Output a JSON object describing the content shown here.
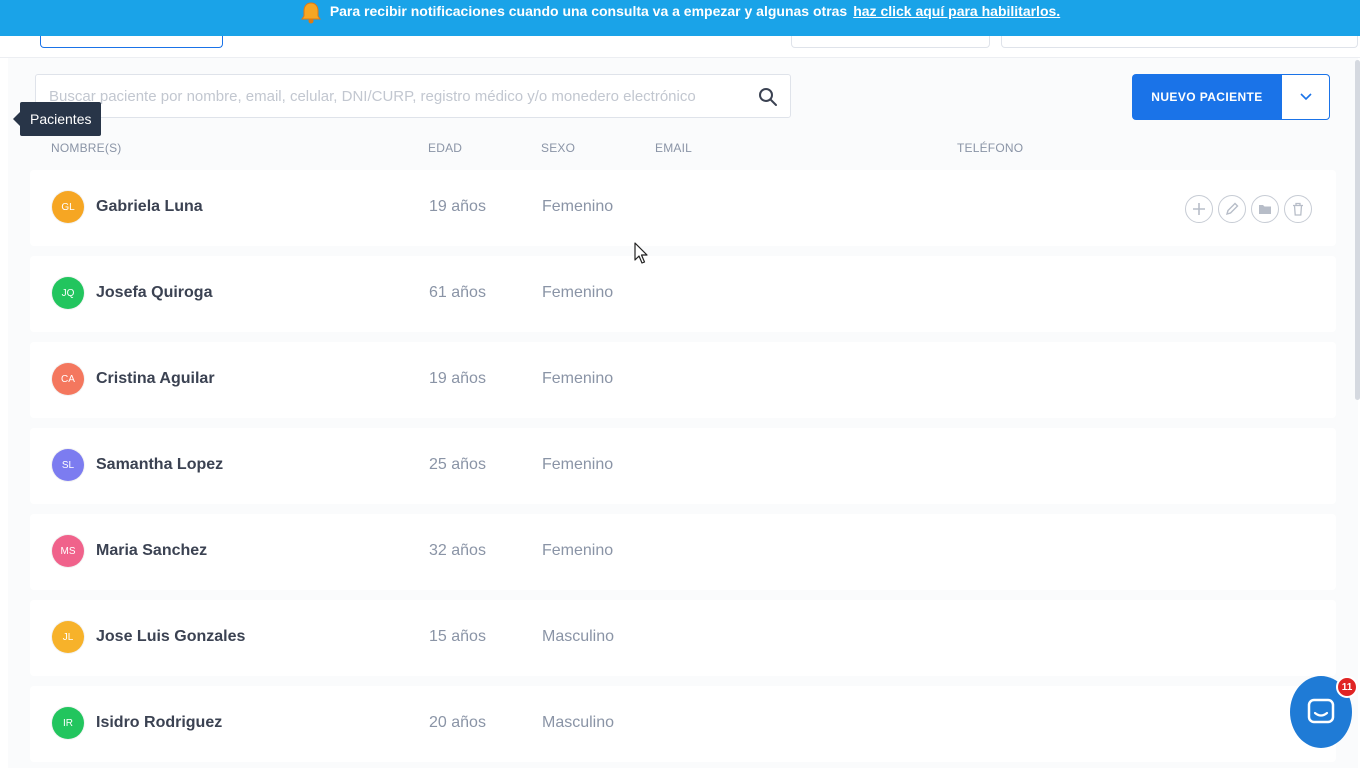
{
  "banner": {
    "text": "Para recibir notificaciones cuando una consulta va a empezar y algunas otras",
    "link": "haz click aquí para habilitarlos."
  },
  "search": {
    "placeholder": "Buscar paciente por nombre, email, celular, DNI/CURP, registro médico y/o monedero electrónico"
  },
  "new_patient": {
    "label": "NUEVO PACIENTE"
  },
  "tooltip": {
    "text": "Pacientes"
  },
  "table": {
    "headers": {
      "name": "NOMBRE(S)",
      "age": "EDAD",
      "sex": "SEXO",
      "email": "EMAIL",
      "phone": "TELÉFONO"
    },
    "rows": [
      {
        "initials": "GL",
        "color": "#f6a623",
        "name": "Gabriela Luna",
        "age": "19 años",
        "sex": "Femenino"
      },
      {
        "initials": "JQ",
        "color": "#22c55e",
        "name": "Josefa Quiroga",
        "age": "61 años",
        "sex": "Femenino"
      },
      {
        "initials": "CA",
        "color": "#f4775e",
        "name": "Cristina Aguilar",
        "age": "19 años",
        "sex": "Femenino"
      },
      {
        "initials": "SL",
        "color": "#7c7cf0",
        "name": "Samantha Lopez",
        "age": "25 años",
        "sex": "Femenino"
      },
      {
        "initials": "MS",
        "color": "#f0628b",
        "name": "Maria Sanchez",
        "age": "32 años",
        "sex": "Femenino"
      },
      {
        "initials": "JL",
        "color": "#f7b22a",
        "name": "Jose Luis Gonzales",
        "age": "15 años",
        "sex": "Masculino"
      },
      {
        "initials": "IR",
        "color": "#22c55e",
        "name": "Isidro Rodriguez",
        "age": "20 años",
        "sex": "Masculino"
      }
    ]
  },
  "row_actions": [
    "plus-icon",
    "pencil-icon",
    "folder-icon",
    "trash-icon"
  ],
  "chat": {
    "badge": "11"
  },
  "colors": {
    "banner": "#1aa3e8",
    "primary": "#1a73e8",
    "chat": "#1f7bd6",
    "badge": "#e02424"
  }
}
